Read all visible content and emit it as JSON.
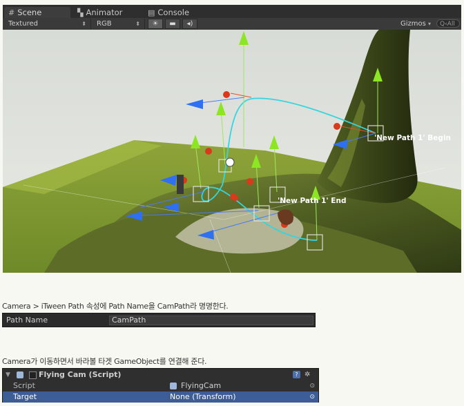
{
  "tabs": [
    {
      "label": "Scene",
      "icon": "scene-grid-icon"
    },
    {
      "label": "Animator",
      "icon": "animator-icon"
    },
    {
      "label": "Console",
      "icon": "console-icon"
    }
  ],
  "toolbar": {
    "render_mode": "Textured",
    "color_mode": "RGB",
    "gizmos": "Gizmos",
    "search_placeholder": "Q‹All"
  },
  "scene": {
    "label_begin": "'New Path 1' Begin",
    "label_end": "'New Path 1' End"
  },
  "caption1": "Camera > iTween Path 속성에 Path Name을 CamPath라 명명한다.",
  "path_field": {
    "label": "Path Name",
    "value": "CamPath"
  },
  "caption2": "Camera가 이동하면서 바라볼 타겟 GameObject를 연결해 준다.",
  "inspector": {
    "title": "Flying Cam (Script)",
    "script_label": "Script",
    "script_value": "FlyingCam",
    "target_label": "Target",
    "target_value": "None (Transform)"
  },
  "colors": {
    "path": "#35d5e0",
    "handle_up": "#8ce624",
    "handle_forward": "#2f6ff2",
    "handle_right": "#d83a1c",
    "selection": "#3d5d96"
  }
}
